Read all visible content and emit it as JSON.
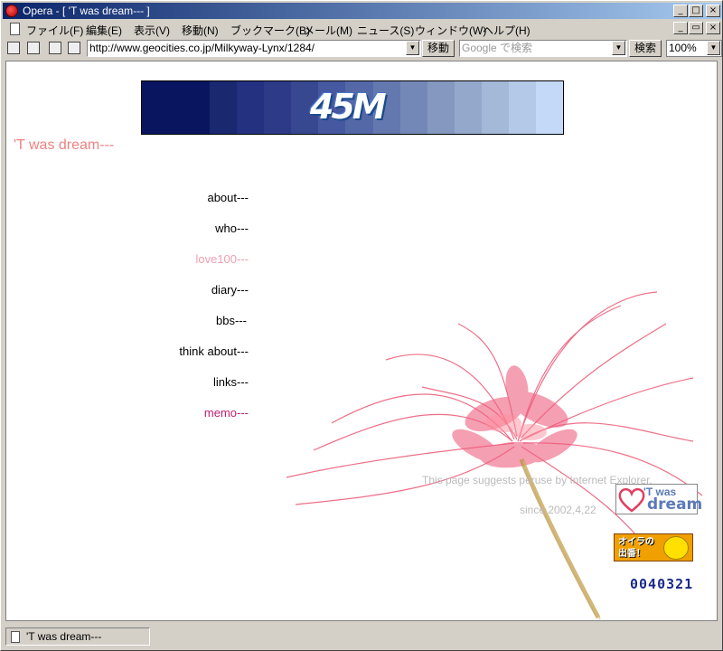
{
  "window": {
    "title": "Opera - [ 'T was dream--- ]",
    "buttons": {
      "minimize": "_",
      "maximize": "□",
      "close": "×",
      "restore": "▭"
    }
  },
  "menu": [
    "ファイル(F)",
    "編集(E)",
    "表示(V)",
    "移動(N)",
    "ブックマーク(B)",
    "メール(M)",
    "ニュース(S)",
    "ウィンドウ(W)",
    "ヘルプ(H)"
  ],
  "toolbar": {
    "url": "http://www.geocities.co.jp/Milkyway-Lynx/1284/",
    "go_label": "移動",
    "search_placeholder": "Google で検索",
    "search_label": "検索",
    "zoom": "100%"
  },
  "page": {
    "banner_text": "45M",
    "title": "'T was dream---",
    "nav": [
      {
        "label": "about---",
        "color": "#000000"
      },
      {
        "label": "who---",
        "color": "#000000"
      },
      {
        "label": "love100---",
        "color": "#f0a0b0"
      },
      {
        "label": "diary---",
        "color": "#000000"
      },
      {
        "label": "bbs---",
        "color": "#000000"
      },
      {
        "label": "think about---",
        "color": "#000000"
      },
      {
        "label": "links---",
        "color": "#000000"
      },
      {
        "label": "memo---",
        "color": "#c02070"
      }
    ],
    "footer_note": "This page suggests peruse by Internet Explorer.",
    "since": "since 2002,4,22",
    "badge_line1": "'T was",
    "badge_line2": "dream",
    "oira_text": "オイラの出番！",
    "counter": "0040321"
  },
  "status": {
    "text": "'T was dream---"
  },
  "colors": {
    "banner": [
      "#0a1560",
      "#1a2870",
      "#243080",
      "#2c3a88",
      "#384890",
      "#4658a0",
      "#5468a8",
      "#6478b0",
      "#7488b8",
      "#8498c0",
      "#94a8cc",
      "#a4b8d8",
      "#b4c8e8",
      "#c4d8f8"
    ]
  }
}
